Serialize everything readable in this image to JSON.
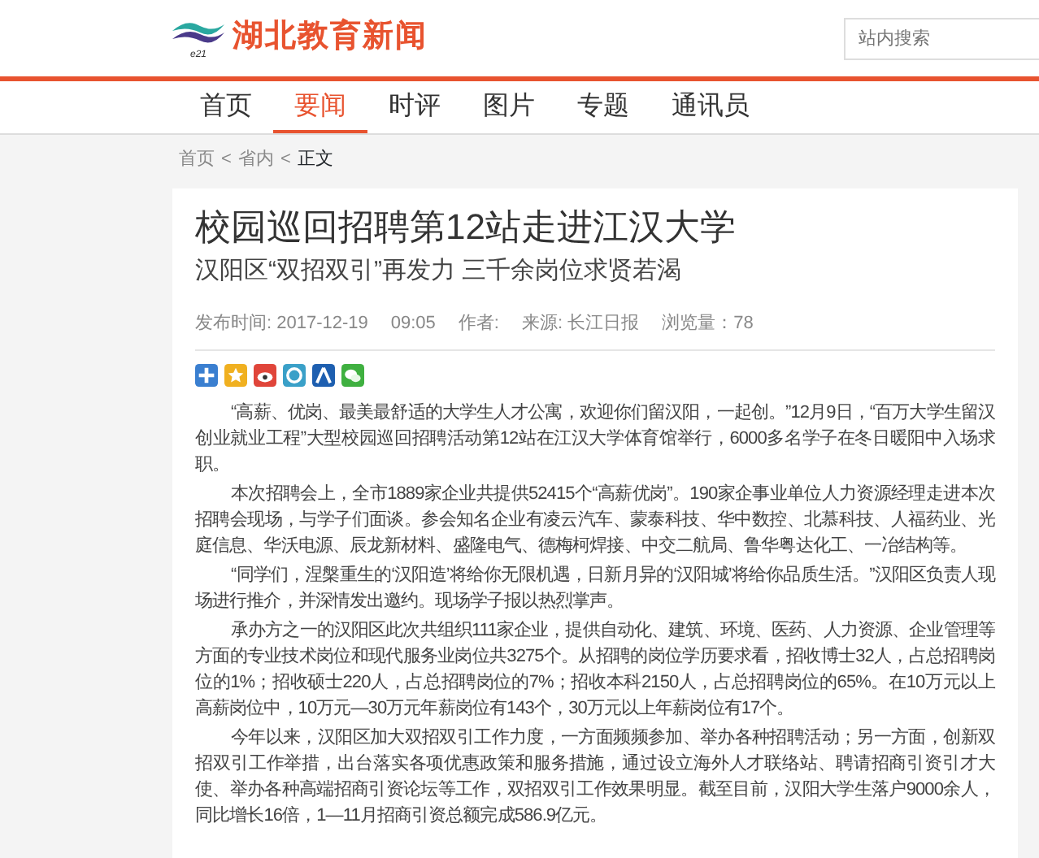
{
  "header": {
    "logo_mark": "e21",
    "site_name": "湖北教育新闻",
    "search": {
      "placeholder": "站内搜索"
    }
  },
  "nav": [
    {
      "label": "首页",
      "selected": false
    },
    {
      "label": "要闻",
      "selected": true
    },
    {
      "label": "时评",
      "selected": false
    },
    {
      "label": "图片",
      "selected": false
    },
    {
      "label": "专题",
      "selected": false
    },
    {
      "label": "通讯员",
      "selected": false
    }
  ],
  "breadcrumb": [
    "首页",
    "省内",
    "正文"
  ],
  "breadcrumb_separator": "<",
  "article": {
    "title": "校园巡回招聘第12站走进江汉大学",
    "subtitle": "汉阳区“双招双引”再发力 三千余岗位求贤若渴",
    "meta": [
      "发布时间: 2017-12-19",
      "09:05",
      "作者:",
      "来源: 长江日报",
      "浏览量：78"
    ],
    "share": [
      {
        "kind": "plus",
        "color": "#3a7fd0"
      },
      {
        "kind": "qzone",
        "color": "#f0b020"
      },
      {
        "kind": "weibo",
        "color": "#e0453a"
      },
      {
        "kind": "tqq",
        "color": "#3aa0c8"
      },
      {
        "kind": "renren",
        "color": "#1e5fb0"
      },
      {
        "kind": "wechat",
        "color": "#3fb040"
      }
    ],
    "paragraphs": [
      "“高薪、优岗、最美最舒适的大学生人才公寓，欢迎你们留汉阳，一起创。”12月9日，“百万大学生留汉创业就业工程”大型校园巡回招聘活动第12站在江汉大学体育馆举行，6000多名学子在冬日暖阳中入场求职。",
      "本次招聘会上，全市1889家企业共提供52415个“高薪优岗”。190家企事业单位人力资源经理走进本次招聘会现场，与学子们面谈。参会知名企业有凌云汽车、蒙泰科技、华中数控、北慕科技、人福药业、光庭信息、华沃电源、辰龙新材料、盛隆电气、德梅柯焊接、中交二航局、鲁华粤达化工、一冶结构等。",
      "“同学们，涅槃重生的‘汉阳造’将给你无限机遇，日新月异的‘汉阳城’将给你品质生活。”汉阳区负责人现场进行推介，并深情发出邀约。现场学子报以热烈掌声。",
      "承办方之一的汉阳区此次共组织111家企业，提供自动化、建筑、环境、医药、人力资源、企业管理等方面的专业技术岗位和现代服务业岗位共3275个。从招聘的岗位学历要求看，招收博士32人，占总招聘岗位的1%；招收硕士220人，占总招聘岗位的7%；招收本科2150人，占总招聘岗位的65%。在10万元以上高薪岗位中，10万元—30万元年薪岗位有143个，30万元以上年薪岗位有17个。",
      "今年以来，汉阳区加大双招双引工作力度，一方面频频参加、举办各种招聘活动；另一方面，创新双招双引工作举措，出台落实各项优惠政策和服务措施，通过设立海外人才联络站、聘请招商引资引才大使、举办各种高端招商引资论坛等工作，双招双引工作效果明显。截至目前，汉阳大学生落户9000余人，同比增长16倍，1—11月招商引资总额完成586.9亿元。"
    ]
  }
}
